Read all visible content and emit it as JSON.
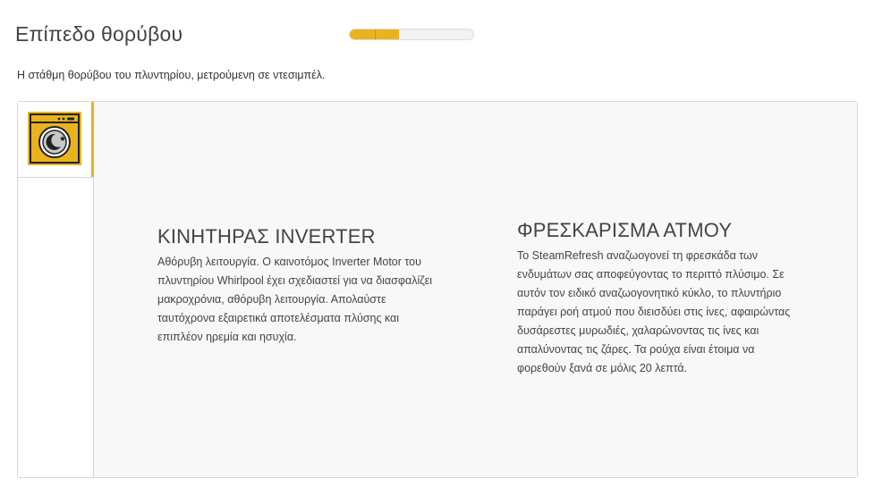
{
  "header": {
    "title": "Επίπεδο θορύβου",
    "noise_level": {
      "filled_segments": 2,
      "total_segments": 5,
      "fraction": 0.4
    },
    "description": "Η στάθμη θορύβου του πλυντηρίου, μετρούμενη σε ντεσιμπέλ."
  },
  "tabs": [
    {
      "icon": "washing-machine-night-mode-icon",
      "selected": true
    }
  ],
  "features": [
    {
      "title": "ΚΙΝΗΤΗΡΑΣ INVERTER",
      "body": "Αθόρυβη λειτουργία. Ο καινοτόμος Inverter Motor του πλυντηρίου Whirlpool έχει σχεδιαστεί για να διασφαλίζει μακροχρόνια, αθόρυβη λειτουργία. Απολαύστε ταυτόχρονα εξαιρετικά αποτελέσματα πλύσης και επιπλέον ηρεμία και ησυχία."
    },
    {
      "title": "ΦΡΕΣΚΑΡΙΣΜΑ ΑΤΜΟΥ",
      "body": "Το SteamRefresh αναζωογονεί τη φρεσκάδα των ενδυμάτων σας αποφεύγοντας το περιττό πλύσιμο. Σε αυτόν τον ειδικό αναζωογονητικό κύκλο, το πλυντήριο παράγει ροή ατμού που διεισδύει στις ίνες, αφαιρώντας δυσάρεστες μυρωδιές, χαλαρώνοντας τις ίνες και απαλύνοντας τις ζάρες. Τα ρούχα είναι έτοιμα να φορεθούν ξανά σε μόλις 20 λεπτά."
    }
  ],
  "colors": {
    "accent": "#eab31d",
    "panel_background": "#f8f8f8",
    "border": "#d7d7d7"
  }
}
